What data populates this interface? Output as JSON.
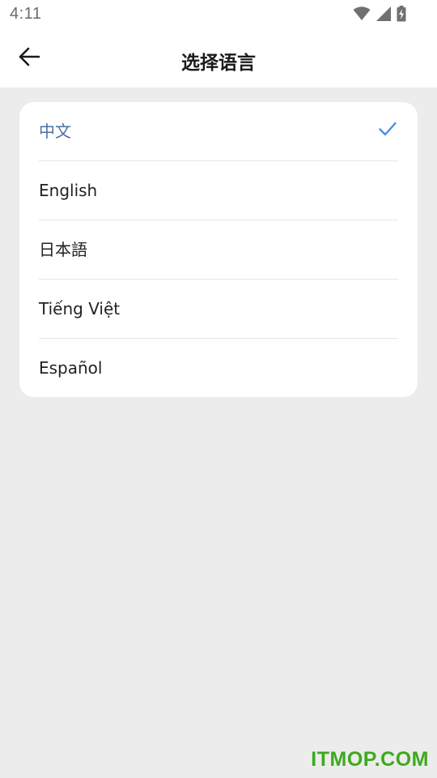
{
  "status_bar": {
    "time": "4:11",
    "icons": [
      "wifi-icon",
      "signal-icon",
      "battery-charging-icon"
    ]
  },
  "header": {
    "back_icon": "arrow-left-icon",
    "title": "选择语言"
  },
  "languages": [
    {
      "label": "中文",
      "selected": true
    },
    {
      "label": "English",
      "selected": false
    },
    {
      "label": "日本語",
      "selected": false
    },
    {
      "label": "Tiếng Việt",
      "selected": false
    },
    {
      "label": "Español",
      "selected": false
    }
  ],
  "colors": {
    "accent": "#4a90e2",
    "selected_text": "#4a6fa5",
    "background": "#ececec",
    "watermark": "#3caa1e"
  },
  "watermark": "ITMOP.COM"
}
